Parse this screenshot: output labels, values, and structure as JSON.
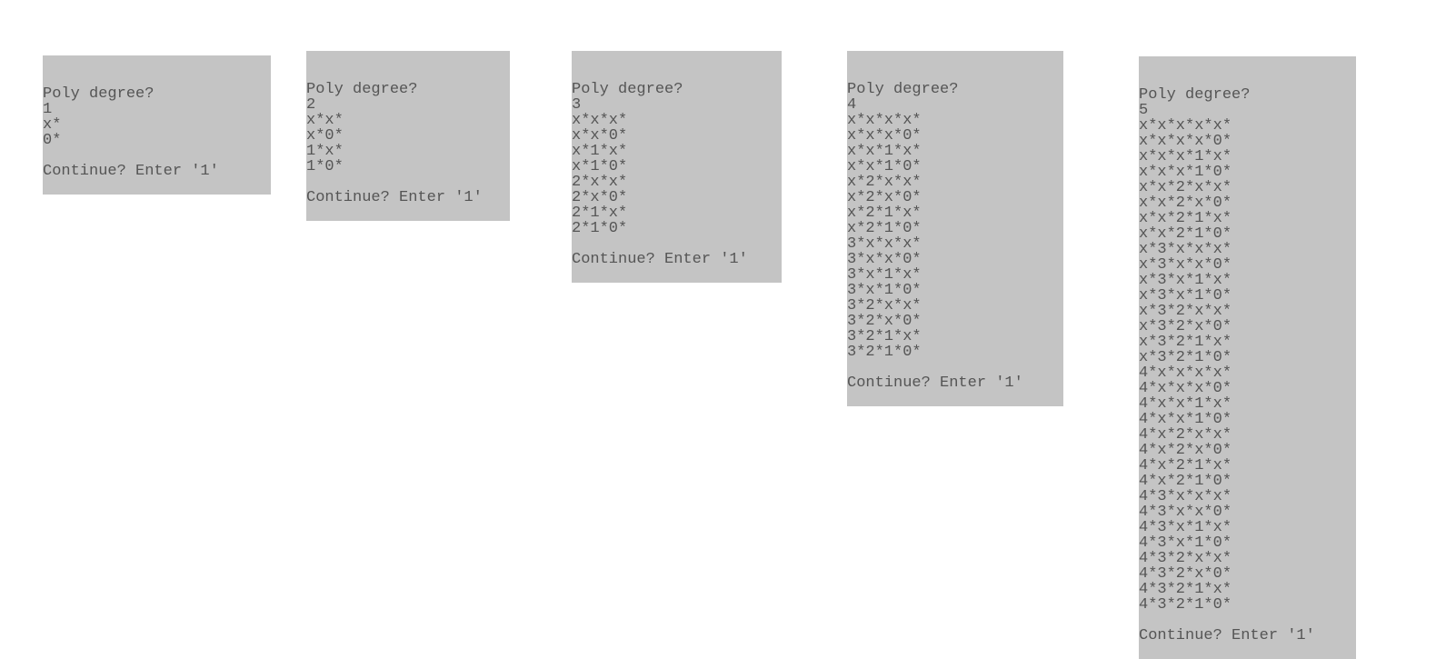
{
  "panels": [
    {
      "id": "panel-1",
      "prompt": "Poly degree?",
      "input": "1",
      "lines": [
        "x*",
        "0*"
      ],
      "spacer": "",
      "continue_prompt": "Continue? Enter '1'"
    },
    {
      "id": "panel-2",
      "prompt": "Poly degree?",
      "input": "2",
      "lines": [
        "x*x*",
        "x*0*",
        "1*x*",
        "1*0*"
      ],
      "spacer": "",
      "continue_prompt": "Continue? Enter '1'"
    },
    {
      "id": "panel-3",
      "prompt": "Poly degree?",
      "input": "3",
      "lines": [
        "x*x*x*",
        "x*x*0*",
        "x*1*x*",
        "x*1*0*",
        "2*x*x*",
        "2*x*0*",
        "2*1*x*",
        "2*1*0*"
      ],
      "spacer": "",
      "continue_prompt": "Continue? Enter '1'"
    },
    {
      "id": "panel-4",
      "prompt": "Poly degree?",
      "input": "4",
      "lines": [
        "x*x*x*x*",
        "x*x*x*0*",
        "x*x*1*x*",
        "x*x*1*0*",
        "x*2*x*x*",
        "x*2*x*0*",
        "x*2*1*x*",
        "x*2*1*0*",
        "3*x*x*x*",
        "3*x*x*0*",
        "3*x*1*x*",
        "3*x*1*0*",
        "3*2*x*x*",
        "3*2*x*0*",
        "3*2*1*x*",
        "3*2*1*0*"
      ],
      "spacer": "",
      "continue_prompt": "Continue? Enter '1'"
    },
    {
      "id": "panel-5",
      "prompt": "Poly degree?",
      "input": "5",
      "lines": [
        "x*x*x*x*x*",
        "x*x*x*x*0*",
        "x*x*x*1*x*",
        "x*x*x*1*0*",
        "x*x*2*x*x*",
        "x*x*2*x*0*",
        "x*x*2*1*x*",
        "x*x*2*1*0*",
        "x*3*x*x*x*",
        "x*3*x*x*0*",
        "x*3*x*1*x*",
        "x*3*x*1*0*",
        "x*3*2*x*x*",
        "x*3*2*x*0*",
        "x*3*2*1*x*",
        "x*3*2*1*0*",
        "4*x*x*x*x*",
        "4*x*x*x*0*",
        "4*x*x*1*x*",
        "4*x*x*1*0*",
        "4*x*2*x*x*",
        "4*x*2*x*0*",
        "4*x*2*1*x*",
        "4*x*2*1*0*",
        "4*3*x*x*x*",
        "4*3*x*x*0*",
        "4*3*x*1*x*",
        "4*3*x*1*0*",
        "4*3*2*x*x*",
        "4*3*2*x*0*",
        "4*3*2*1*x*",
        "4*3*2*1*0*"
      ],
      "spacer": "",
      "continue_prompt": "Continue? Enter '1'"
    }
  ]
}
